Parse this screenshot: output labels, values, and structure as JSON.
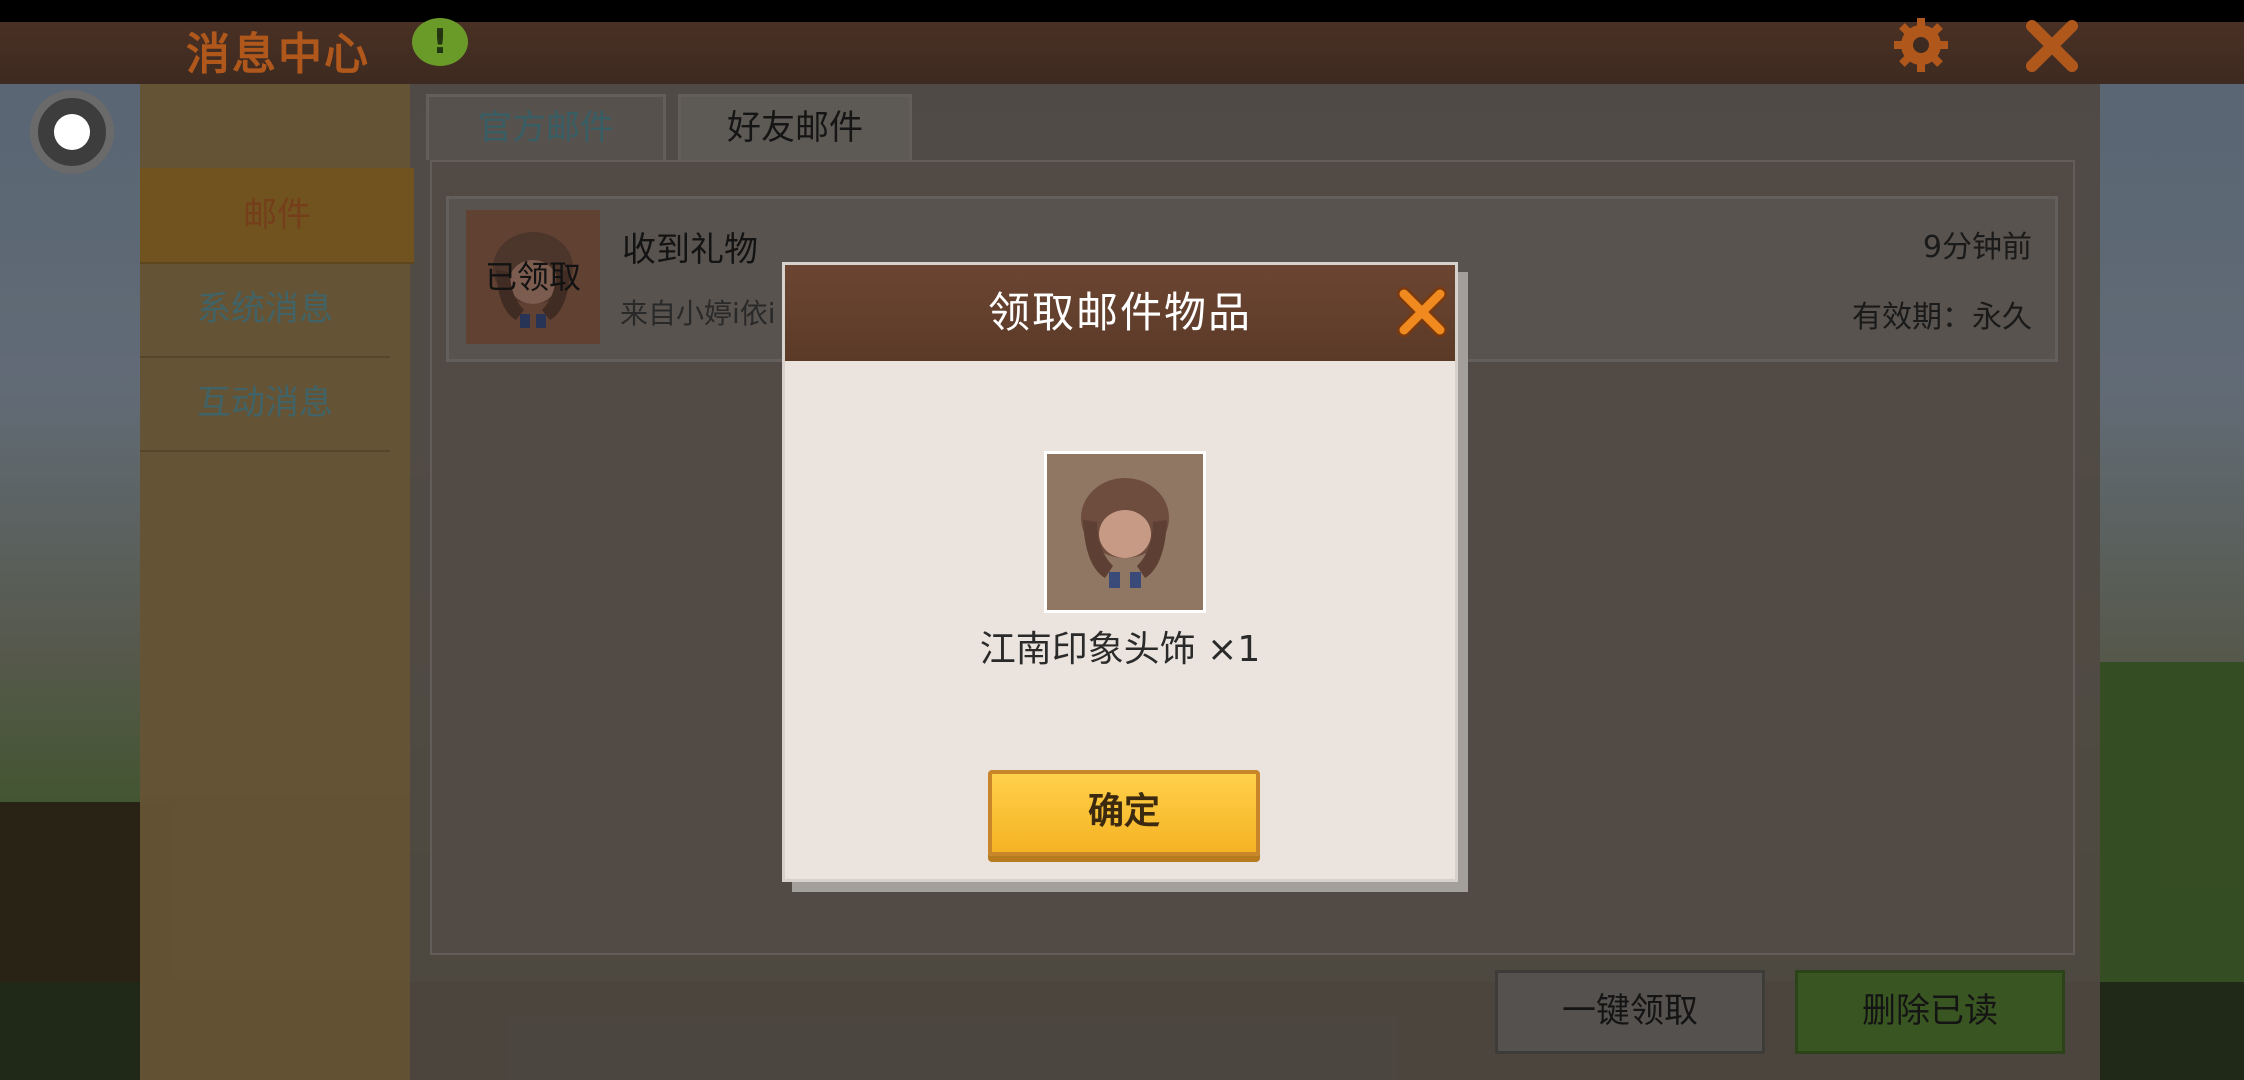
{
  "app": {
    "title": "消息中心",
    "alert_icon_text": "!",
    "gear_icon": "gear-icon",
    "close_icon": "close-icon"
  },
  "sidebar": {
    "items": [
      {
        "label": "邮件",
        "active": true
      },
      {
        "label": "系统消息",
        "active": false
      },
      {
        "label": "互动消息",
        "active": false
      }
    ]
  },
  "tabs": [
    {
      "label": "官方邮件",
      "active": false
    },
    {
      "label": "好友邮件",
      "active": true
    }
  ],
  "mail_list": [
    {
      "title": "收到礼物",
      "sender": "来自小婷i依i",
      "stamp": "已领取",
      "time": "9分钟前",
      "validity": "有效期：永久"
    }
  ],
  "buttons": {
    "claim_all": "一键领取",
    "delete_read": "删除已读"
  },
  "modal": {
    "title": "领取邮件物品",
    "item_name": "江南印象头饰 ×1",
    "confirm": "确定"
  },
  "colors": {
    "accent_orange": "#e8781c",
    "confirm_yellow": "#ffc93a",
    "modal_header": "#653f2d",
    "delete_green": "#527a30"
  }
}
